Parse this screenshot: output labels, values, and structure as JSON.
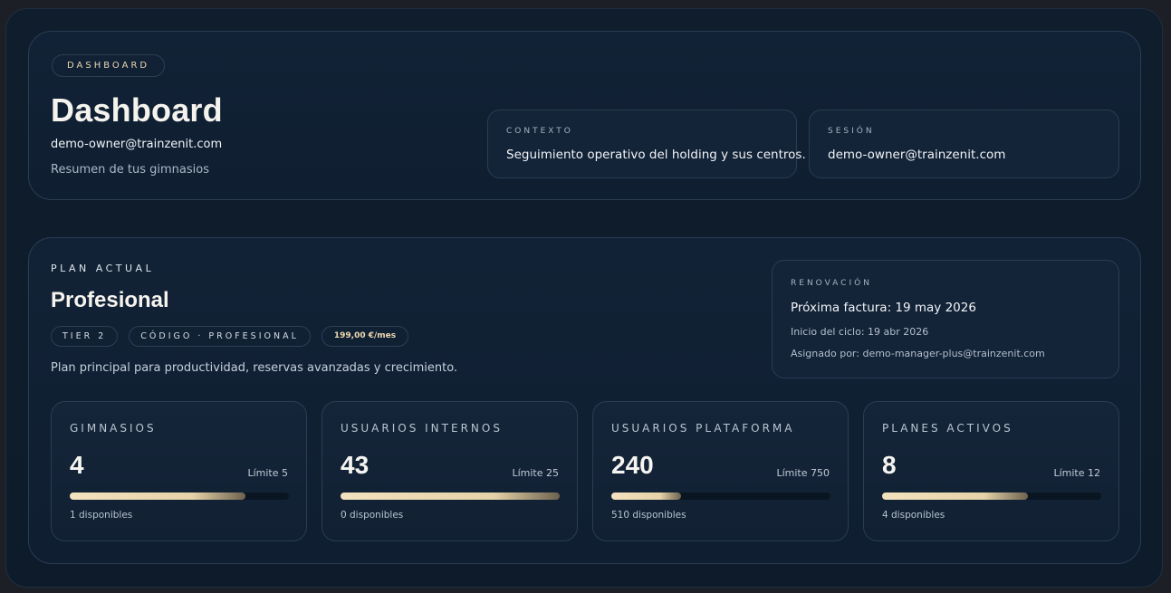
{
  "header": {
    "pill": "DASHBOARD",
    "title": "Dashboard",
    "email": "demo-owner@trainzenit.com",
    "subtitle": "Resumen de tus gimnasios",
    "context": {
      "label": "CONTEXTO",
      "value": "Seguimiento operativo del holding y sus centros."
    },
    "session": {
      "label": "SESIÓN",
      "value": "demo-owner@trainzenit.com"
    }
  },
  "plan": {
    "label": "PLAN ACTUAL",
    "name": "Profesional",
    "tags": {
      "tier": "TIER 2",
      "code": "CÓDIGO · PROFESIONAL",
      "price": "199,00 €/mes"
    },
    "description": "Plan principal para productividad, reservas avanzadas y crecimiento.",
    "renewal": {
      "label": "RENOVACIÓN",
      "next_invoice": "Próxima factura: 19 may 2026",
      "cycle_start": "Inicio del ciclo: 19 abr 2026",
      "assigned_by": "Asignado por: demo-manager-plus@trainzenit.com"
    }
  },
  "stats": [
    {
      "label": "GIMNASIOS",
      "value": "4",
      "limit": "Límite 5",
      "available": "1 disponibles",
      "fill_ratio": 0.8
    },
    {
      "label": "USUARIOS INTERNOS",
      "value": "43",
      "limit": "Límite 25",
      "available": "0 disponibles",
      "fill_ratio": 1.0
    },
    {
      "label": "USUARIOS PLATAFORMA",
      "value": "240",
      "limit": "Límite 750",
      "available": "510 disponibles",
      "fill_ratio": 0.32
    },
    {
      "label": "PLANES ACTIVOS",
      "value": "8",
      "limit": "Límite 12",
      "available": "4 disponibles",
      "fill_ratio": 0.667
    }
  ],
  "colors": {
    "accent": "#e9d7b2",
    "background": "#0f1d2d",
    "border": "#2a3d54"
  }
}
